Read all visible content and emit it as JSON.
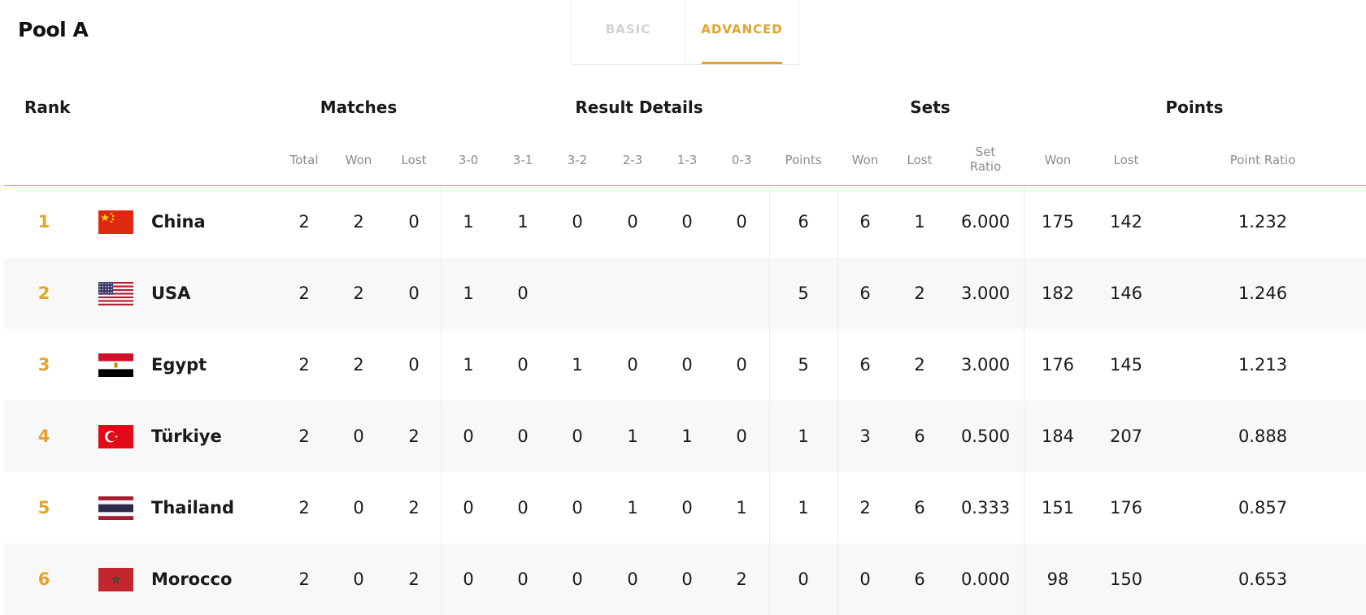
{
  "pool_title": "Pool A",
  "tabs": [
    {
      "label": "BASIC",
      "active": false
    },
    {
      "label": "ADVANCED",
      "active": true
    }
  ],
  "groups": {
    "rank": "Rank",
    "matches": "Matches",
    "result_details": "Result Details",
    "sets": "Sets",
    "points": "Points"
  },
  "columns": {
    "total": "Total",
    "won": "Won",
    "lost": "Lost",
    "r30": "3-0",
    "r31": "3-1",
    "r32": "3-2",
    "r23": "2-3",
    "r13": "1-3",
    "r03": "0-3",
    "points": "Points",
    "sets_won": "Won",
    "sets_lost": "Lost",
    "set_ratio_1": "Set",
    "set_ratio_2": "Ratio",
    "pts_won": "Won",
    "pts_lost": "Lost",
    "point_ratio": "Point Ratio"
  },
  "colors": {
    "accent": "#e4a32c"
  },
  "rows": [
    {
      "rank": "1",
      "country": "China",
      "flag": "flag-china-icon",
      "total": "2",
      "won": "2",
      "lost": "0",
      "r30": "1",
      "r31": "1",
      "r32": "0",
      "r23": "0",
      "r13": "0",
      "r03": "0",
      "points": "6",
      "sets_won": "6",
      "sets_lost": "1",
      "set_ratio": "6.000",
      "pts_won": "175",
      "pts_lost": "142",
      "point_ratio": "1.232"
    },
    {
      "rank": "2",
      "country": "USA",
      "flag": "flag-usa-icon",
      "total": "2",
      "won": "2",
      "lost": "0",
      "r30": "1",
      "r31": "0",
      "r32": "",
      "r23": "",
      "r13": "",
      "r03": "",
      "points": "5",
      "sets_won": "6",
      "sets_lost": "2",
      "set_ratio": "3.000",
      "pts_won": "182",
      "pts_lost": "146",
      "point_ratio": "1.246"
    },
    {
      "rank": "3",
      "country": "Egypt",
      "flag": "flag-egypt-icon",
      "total": "2",
      "won": "2",
      "lost": "0",
      "r30": "1",
      "r31": "0",
      "r32": "1",
      "r23": "0",
      "r13": "0",
      "r03": "0",
      "points": "5",
      "sets_won": "6",
      "sets_lost": "2",
      "set_ratio": "3.000",
      "pts_won": "176",
      "pts_lost": "145",
      "point_ratio": "1.213"
    },
    {
      "rank": "4",
      "country": "Türkiye",
      "flag": "flag-turkiye-icon",
      "total": "2",
      "won": "0",
      "lost": "2",
      "r30": "0",
      "r31": "0",
      "r32": "0",
      "r23": "1",
      "r13": "1",
      "r03": "0",
      "points": "1",
      "sets_won": "3",
      "sets_lost": "6",
      "set_ratio": "0.500",
      "pts_won": "184",
      "pts_lost": "207",
      "point_ratio": "0.888"
    },
    {
      "rank": "5",
      "country": "Thailand",
      "flag": "flag-thailand-icon",
      "total": "2",
      "won": "0",
      "lost": "2",
      "r30": "0",
      "r31": "0",
      "r32": "0",
      "r23": "1",
      "r13": "0",
      "r03": "1",
      "points": "1",
      "sets_won": "2",
      "sets_lost": "6",
      "set_ratio": "0.333",
      "pts_won": "151",
      "pts_lost": "176",
      "point_ratio": "0.857"
    },
    {
      "rank": "6",
      "country": "Morocco",
      "flag": "flag-morocco-icon",
      "total": "2",
      "won": "0",
      "lost": "2",
      "r30": "0",
      "r31": "0",
      "r32": "0",
      "r23": "0",
      "r13": "0",
      "r03": "2",
      "points": "0",
      "sets_won": "0",
      "sets_lost": "6",
      "set_ratio": "0.000",
      "pts_won": "98",
      "pts_lost": "150",
      "point_ratio": "0.653"
    }
  ]
}
